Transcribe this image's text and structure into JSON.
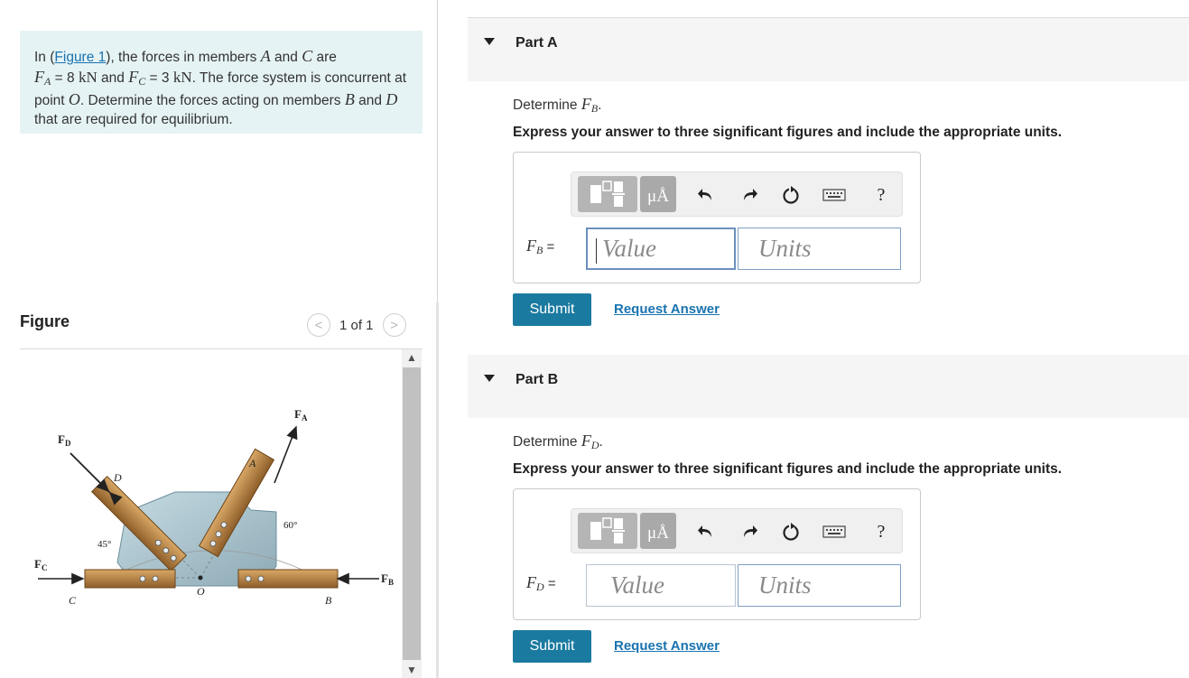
{
  "problem": {
    "t1": "In (",
    "figure_link": "Figure 1",
    "t2": "), the forces in members ",
    "member_a": "A",
    "t3": " and ",
    "member_c": "C",
    "t4": " are",
    "fa_symbol": "F",
    "fa_sub": "A",
    "fa_value": " = 8 ",
    "fa_unit": "kN",
    "t5": " and ",
    "fc_symbol": "F",
    "fc_sub": "C",
    "fc_value": " = 3 ",
    "fc_unit": "kN",
    "t6": ". The force system is concurrent at point ",
    "point": "O",
    "t7": ". Determine the forces acting on members ",
    "member_b": "B",
    "t8": " and ",
    "member_d": "D",
    "t9": " that are required for equilibrium."
  },
  "figure": {
    "title": "Figure",
    "pager": "1 of 1",
    "prev_glyph": "<",
    "next_glyph": ">",
    "labels": {
      "fa": "F",
      "fa_sub": "A",
      "fd": "F",
      "fd_sub": "D",
      "fc": "F",
      "fc_sub": "C",
      "fb": "F",
      "fb_sub": "B",
      "a": "A",
      "b": "B",
      "c": "C",
      "d": "D",
      "o": "O",
      "angle60": "60°",
      "angle45": "45°"
    }
  },
  "part_a": {
    "title": "Part A",
    "question_prefix": "Determine ",
    "question_symbol": "F",
    "question_sub": "B",
    "question_suffix": ".",
    "instruction": "Express your answer to three significant figures and include the appropriate units.",
    "var_symbol": "F",
    "var_sub": "B",
    "equals": " =",
    "value_placeholder": "Value",
    "units_placeholder": "Units",
    "submit": "Submit",
    "request": "Request Answer"
  },
  "part_b": {
    "title": "Part B",
    "question_prefix": "Determine ",
    "question_symbol": "F",
    "question_sub": "D",
    "question_suffix": ".",
    "instruction": "Express your answer to three significant figures and include the appropriate units.",
    "var_symbol": "F",
    "var_sub": "D",
    "equals": " =",
    "value_placeholder": "Value",
    "units_placeholder": "Units",
    "submit": "Submit",
    "request": "Request Answer"
  },
  "toolbar": {
    "units_glyph": "μÅ",
    "help_glyph": "?",
    "icons": [
      "templates-icon",
      "units-icon",
      "undo-icon",
      "redo-icon",
      "reset-icon",
      "keyboard-icon",
      "help-icon"
    ]
  },
  "colors": {
    "problem_bg": "#e6f3f5",
    "link": "#1a73b0",
    "submit_bg": "#1b7aa0",
    "part_header_bg": "#f5f5f5",
    "gusset": "#a9c3cc",
    "member_wood": "#b8864a"
  }
}
